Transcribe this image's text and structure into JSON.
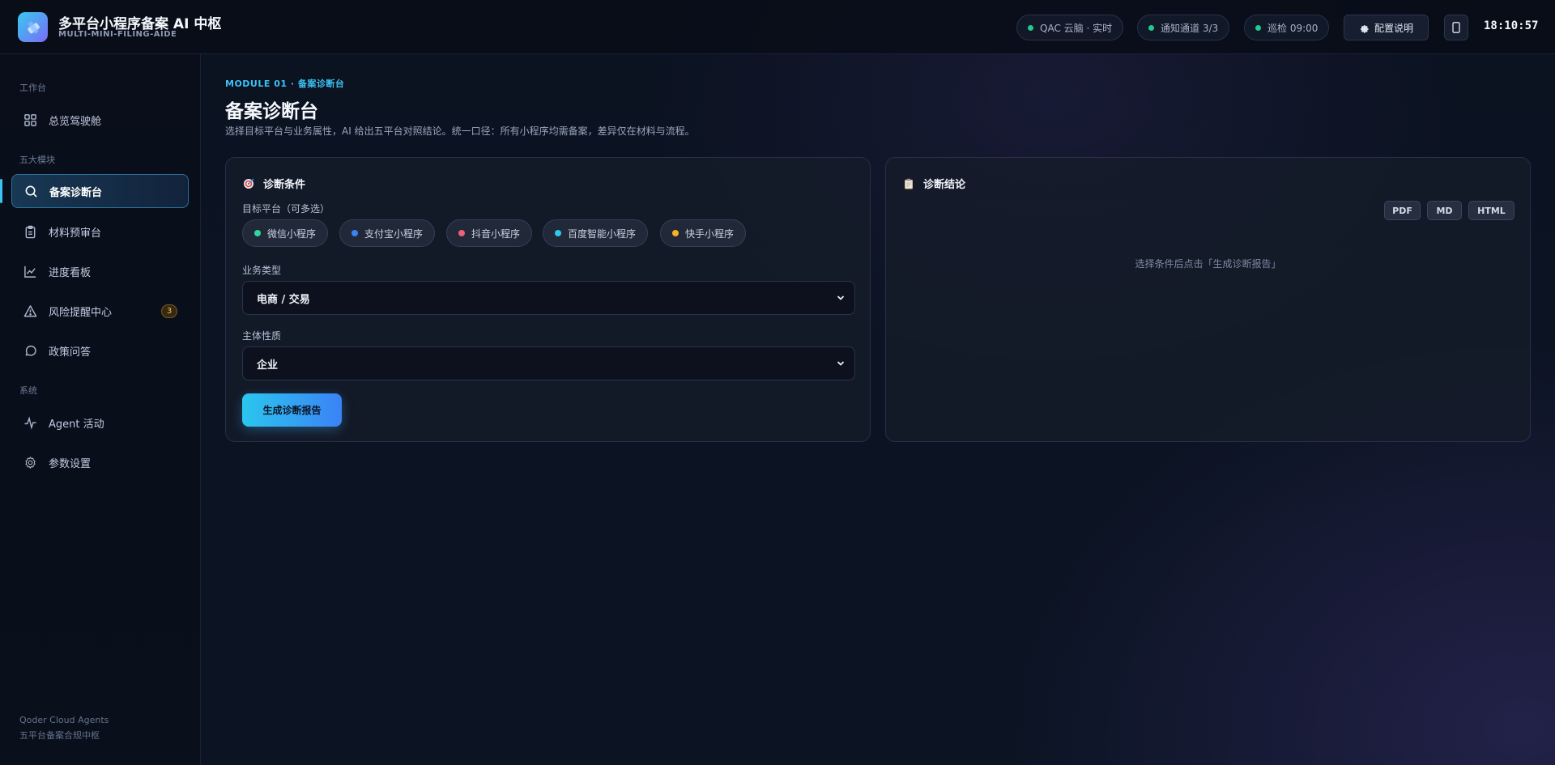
{
  "header": {
    "title": "多平台小程序备案 AI 中枢",
    "subtitle": "MULTI-MINI-FILING-AIDE",
    "status_pills": [
      {
        "label": "QAC 云脑 · 实时"
      },
      {
        "label": "通知通道 3/3"
      },
      {
        "label": "巡检 09:00"
      }
    ],
    "config_label": "配置说明",
    "clock": "18:10:57",
    "colors": {
      "status_dot": "#22c993"
    }
  },
  "sidebar": {
    "sections": {
      "workspace": "工作台",
      "modules": "五大模块",
      "system": "系统"
    },
    "items": [
      {
        "label": "总览驾驶舱",
        "icon": "grid-icon"
      },
      {
        "label": "备案诊断台",
        "icon": "search-icon",
        "active": true
      },
      {
        "label": "材料预审台",
        "icon": "clipboard-icon"
      },
      {
        "label": "进度看板",
        "icon": "chart-line-icon"
      },
      {
        "label": "风险提醒中心",
        "icon": "warning-icon",
        "badge": "3"
      },
      {
        "label": "政策问答",
        "icon": "chat-bubble-icon"
      },
      {
        "label": "Agent 活动",
        "icon": "activity-icon"
      },
      {
        "label": "参数设置",
        "icon": "gear-icon"
      }
    ],
    "footer": {
      "line1": "Qoder Cloud Agents",
      "line2": "五平台备案合规中枢"
    }
  },
  "main": {
    "eyebrow": "MODULE 01 · 备案诊断台",
    "title": "备案诊断台",
    "description": "选择目标平台与业务属性，AI 给出五平台对照结论。统一口径：所有小程序均需备案，差异仅在材料与流程。",
    "conditions": {
      "title": "诊断条件",
      "platform_label": "目标平台（可多选）",
      "platforms": [
        {
          "label": "微信小程序",
          "color": "#2fd6a0"
        },
        {
          "label": "支付宝小程序",
          "color": "#3b82f6"
        },
        {
          "label": "抖音小程序",
          "color": "#f0607a"
        },
        {
          "label": "百度智能小程序",
          "color": "#2ec8e8"
        },
        {
          "label": "快手小程序",
          "color": "#f5b324"
        }
      ],
      "business_label": "业务类型",
      "business_value": "电商 / 交易",
      "entity_label": "主体性质",
      "entity_value": "企业",
      "submit_label": "生成诊断报告"
    },
    "result": {
      "title": "诊断结论",
      "exports": [
        "PDF",
        "MD",
        "HTML"
      ],
      "empty_hint": "选择条件后点击「生成诊断报告」"
    }
  }
}
